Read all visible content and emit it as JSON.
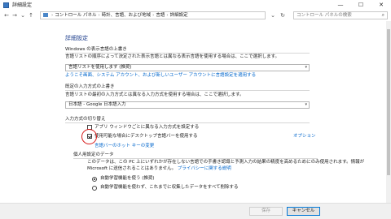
{
  "window": {
    "title": "詳細設定",
    "minimize": "—",
    "maximize": "☐",
    "close": "✕"
  },
  "nav": {
    "back": "←",
    "forward": "→",
    "dropdown": "⌄",
    "up": "↑",
    "breadcrumb": [
      "コントロール パネル",
      "時計、言語、および地域",
      "言語",
      "詳細設定"
    ],
    "sep": "›",
    "refresh": "↻",
    "search_placeholder": "コントロール パネルの検索"
  },
  "page": {
    "title": "詳細設定",
    "display_lang": {
      "header": "Windows の表示言語の上書き",
      "desc": "言語リストの順序によって決定された表示言語とは異なる表示言語を使用する場合は、ここで選択します。",
      "select_value": "言語リストを使用します (推奨)",
      "link": "ようこそ画面、システム アカウント、および新しいユーザー アカウントに言語設定を適用する"
    },
    "input_method": {
      "header": "既定の入力方式の上書き",
      "desc": "言語リストの最初の入力方式とは異なる入力方式を使用する場合は、ここで選択します。",
      "select_value": "日本語 - Google 日本語入力"
    },
    "switching": {
      "header": "入力方式の切り替え",
      "per_app_label": "アプリ ウィンドウごとに異なる入力方式を設定する",
      "per_app_checked": false,
      "desktop_bar_label": "使用可能な場合にデスクトップ言語バーを使用する",
      "desktop_bar_checked": true,
      "options_link": "オプション",
      "hotkey_link": "言語バーのホット キーの変更"
    },
    "personalization": {
      "header": "個人用設定のデータ",
      "desc_line1": "このデータは、この PC 上にいずれかが存在しない言語での手書き認識と予測入力の結果の精度を高めるためにのみ使用されます。情報が",
      "desc_line2_text": "Microsoft に送信されることはありません。",
      "privacy_link": "プライバシーに関する説明",
      "radio_auto": "自動学習機能を使う (推奨)",
      "radio_auto_selected": true,
      "radio_off": "自動学習機能を使わず、これまでに収集したデータをすべて削除する",
      "radio_off_selected": false
    }
  },
  "footer": {
    "save": "保存",
    "cancel": "キャンセル"
  },
  "colors": {
    "heading": "#1e3e8c",
    "link": "#0066cc",
    "annotation": "#d81e1e"
  }
}
